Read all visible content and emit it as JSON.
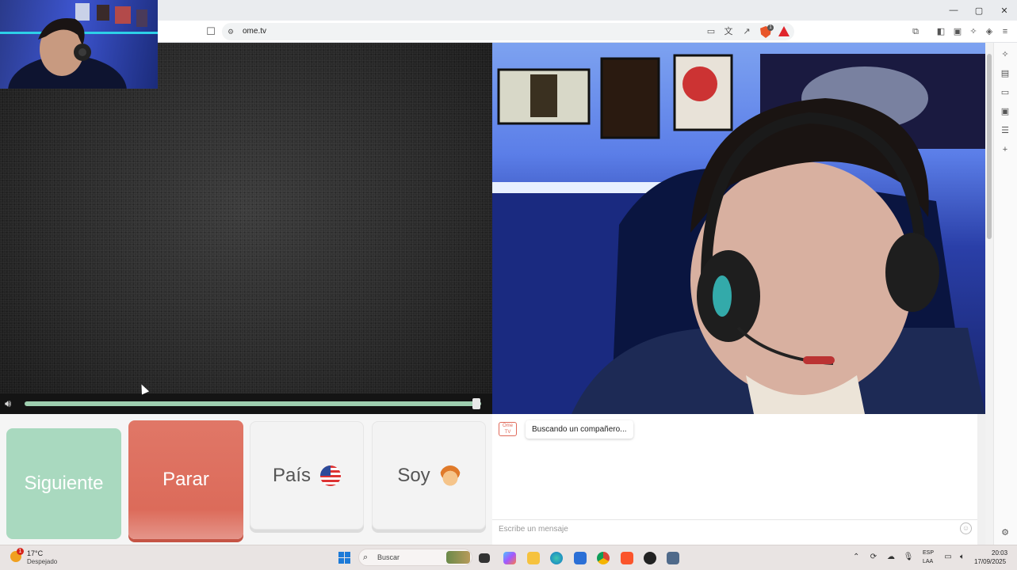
{
  "browser": {
    "url": "ome.tv",
    "window_controls": {
      "minimize": "—",
      "maximize": "▢",
      "close": "✕"
    },
    "shield_count": "1"
  },
  "controls": {
    "next_label": "Siguiente",
    "stop_label": "Parar",
    "country_label": "País",
    "gender_label": "Soy",
    "volume_level": 0.99
  },
  "chat": {
    "logo_text": "Ome TV",
    "status_message": "Buscando un compañero...",
    "input_placeholder": "Escribe un mensaje"
  },
  "taskbar": {
    "weather_badge": "1",
    "temperature": "17°C",
    "weather_condition": "Despejado",
    "search_placeholder": "Buscar",
    "language_1": "ESP",
    "language_2": "LAA",
    "time": "20:03",
    "date": "17/09/2025"
  },
  "colors": {
    "next_button": "#a9d9bf",
    "stop_button": "#dc6b5a",
    "volume_track": "#9fcfb0",
    "brave_orange": "#e8562a"
  }
}
